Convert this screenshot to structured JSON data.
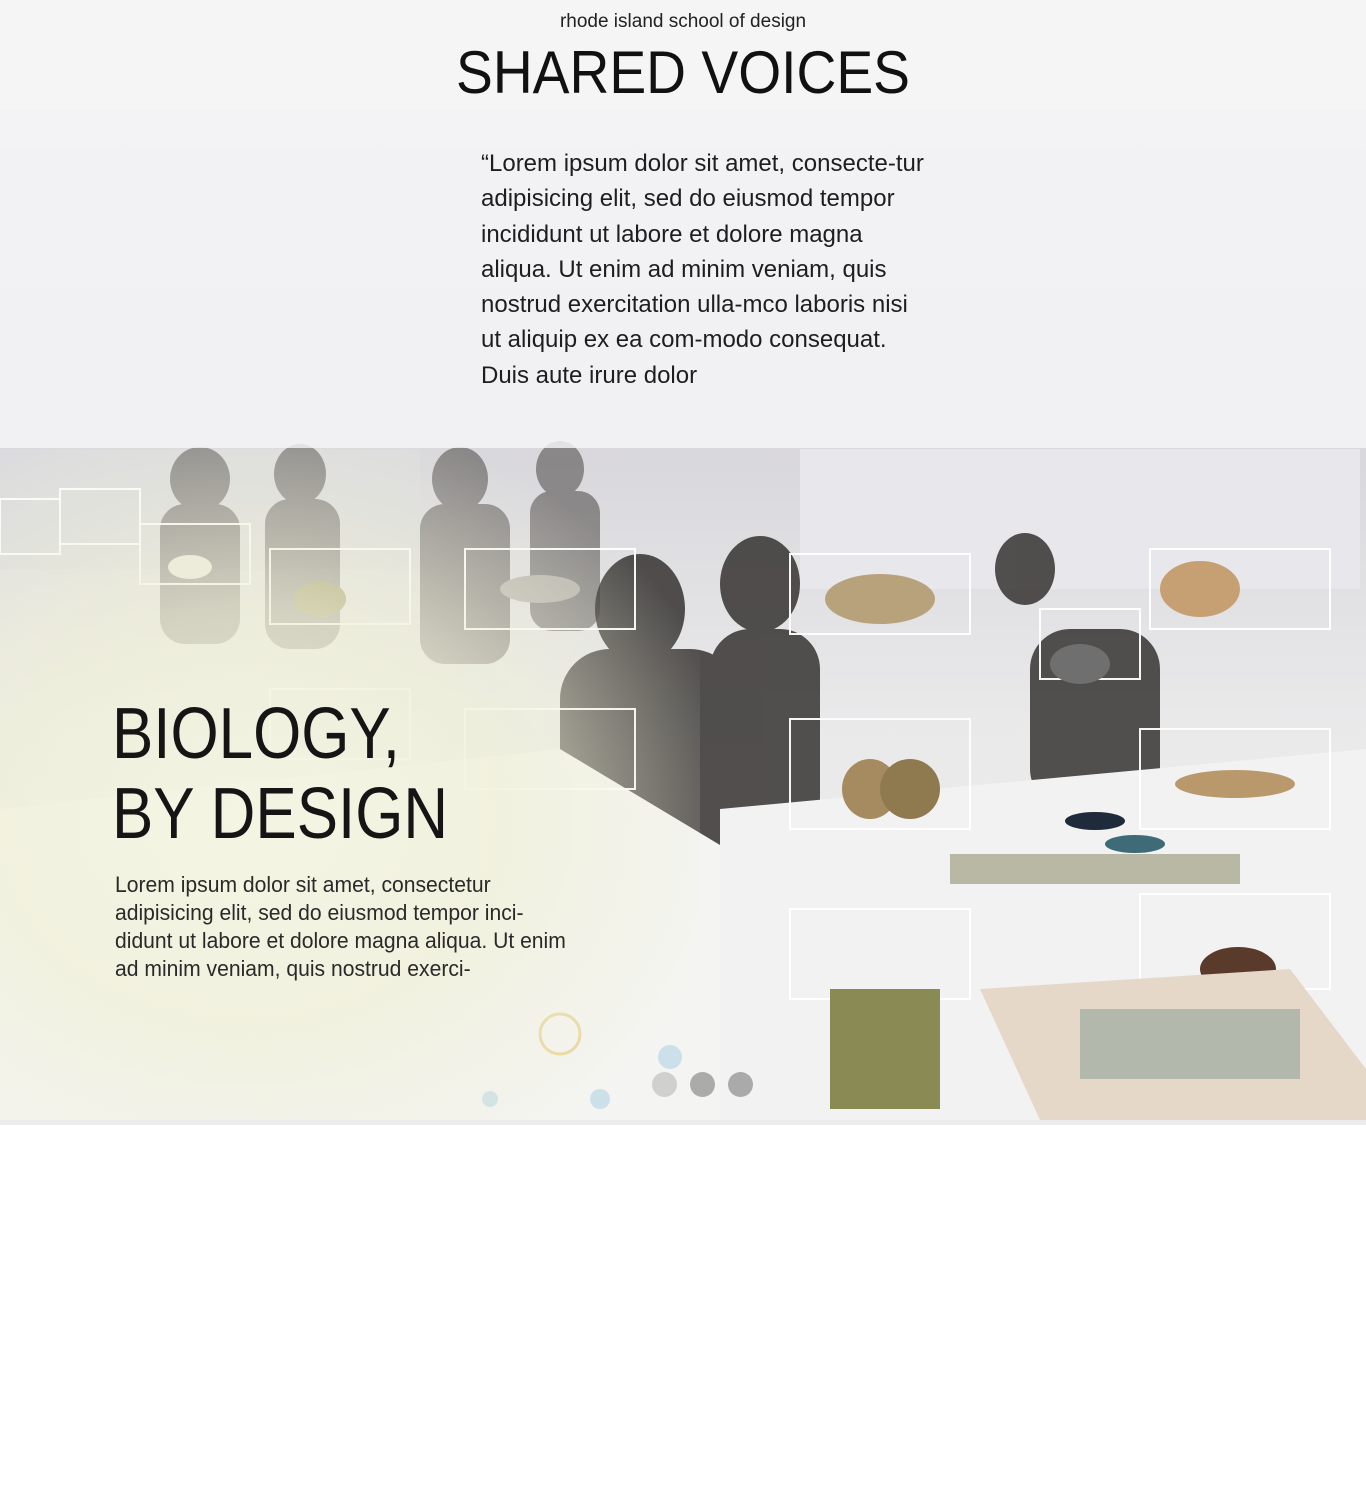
{
  "header": {
    "org": "rhode island school of design",
    "title": "SHARED VOICES"
  },
  "quote": {
    "text": "“Lorem ipsum dolor sit amet, consecte-tur adipisicing elit, sed do eiusmod tempor incididunt ut labore et dolore magna aliqua. Ut enim ad minim veniam, quis nostrud exercitation ulla-mco laboris nisi ut aliquip ex ea com-modo consequat. Duis aute irure dolor"
  },
  "slide": {
    "title_line1": "BIOLOGY,",
    "title_line2": "BY DESIGN",
    "body": "Lorem ipsum dolor sit amet, consectetur adipisicing elit, sed do eiusmod tempor inci-didunt ut labore et dolore magna aliqua. Ut enim ad minim veniam, quis nostrud exerci-"
  },
  "carousel": {
    "slide_count": 3,
    "active_index": 0
  }
}
